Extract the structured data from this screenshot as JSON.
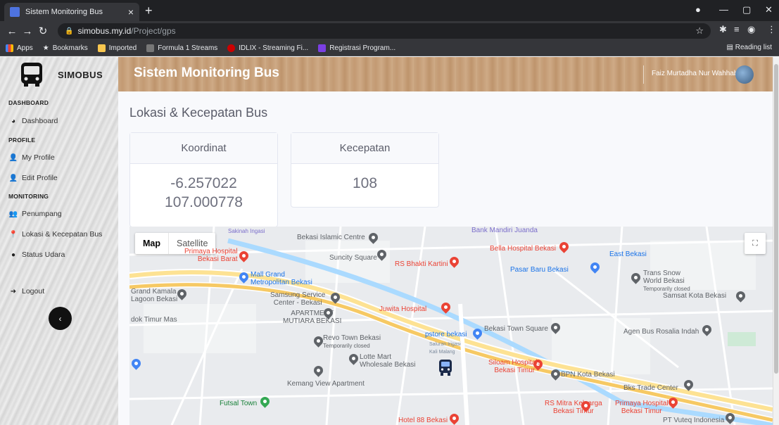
{
  "browser": {
    "tab_title": "Sistem Monitoring Bus",
    "url_host": "simobus.my.id",
    "url_path": "/Project/gps",
    "bookmarks": [
      "Apps",
      "Bookmarks",
      "Imported",
      "Formula 1 Streams",
      "IDLIX - Streaming Fi...",
      "Registrasi Program..."
    ],
    "reading_list": "Reading list"
  },
  "sidebar": {
    "brand": "SIMOBUS",
    "sections": {
      "dashboard": "DASHBOARD",
      "profile": "PROFILE",
      "monitoring": "MONITORING"
    },
    "items": {
      "dashboard": "Dashboard",
      "my_profile": "My Profile",
      "edit_profile": "Edit Profile",
      "penumpang": "Penumpang",
      "lokasi": "Lokasi & Kecepatan Bus",
      "status_udara": "Status Udara",
      "logout": "Logout"
    }
  },
  "header": {
    "title": "Sistem Monitoring Bus",
    "user_name": "Faiz Murtadha Nur Wahhab"
  },
  "main": {
    "page_title": "Lokasi & Kecepatan Bus",
    "koordinat_label": "Koordinat",
    "latitude": "-6.257022",
    "longitude": "107.000778",
    "kecepatan_label": "Kecepatan",
    "kecepatan_value": "108"
  },
  "map": {
    "map_button": "Map",
    "satellite_button": "Satellite",
    "labels": {
      "sakinah": "Sakinah Ingasi",
      "bekasi_islamic": "Bekasi Islamic Centre",
      "bank_mandiri": "Bank Mandiri Juanda",
      "primaya_barat": "Primaya Hospital\nBekasi Barat",
      "suncity": "Suncity Square",
      "rs_bhakti": "RS Bhakti Kartini",
      "bella": "Bella Hospital Bekasi",
      "east_bekasi": "East Bekasi",
      "pasar_baru": "Pasar Baru Bekasi",
      "trans_snow": "Trans Snow\nWorld Bekasi",
      "temp_closed": "Temporarily closed",
      "mall_grand": "Mall Grand\nMetropolitan Bekasi",
      "grand_kamala": "Grand Kamala\nLagoon Bekasi",
      "samsung": "Samsung Service\nCenter - Bekasi",
      "samsat": "Samsat Kota Bekasi",
      "apartment": "APARTMENT\nMUTIARA BEKASI",
      "juwita": "Juwita Hospital",
      "dok_timur": "dok Timur Mas",
      "revo": "Revo Town Bekasi",
      "revo_closed": "Temporarily closed",
      "pstore": "pstore bekasi",
      "bekasi_town": "Bekasi Town Square",
      "agen_bus": "Agen Bus Rosalia Indah",
      "lotte": "Lotte Mart\nWholesale Bekasi",
      "saluran": "Saluran Irigasi\nKali Malang",
      "siloam": "Siloam Hospitals\nBekasi Timur",
      "bpn": "BPN Kota Bekasi",
      "kemang": "Kemang View Apartment",
      "bks_trade": "Bks Trade Center",
      "futsal": "Futsal Town",
      "rs_mitra": "RS Mitra Keluarga\nBekasi Timur",
      "primaya_timur": "Primaya Hospital\nBekasi Timur",
      "hotel88": "Hotel 88 Bekasi",
      "pt_vuteq": "PT Vuteq Indonesia"
    }
  },
  "colors": {
    "tab_bg": "#202124",
    "header_text": "#ffffff",
    "hospital": "#ea4335",
    "place": "#5f6368",
    "shopping": "#4285f4",
    "park": "#34a853",
    "highway": "#f6c964"
  }
}
